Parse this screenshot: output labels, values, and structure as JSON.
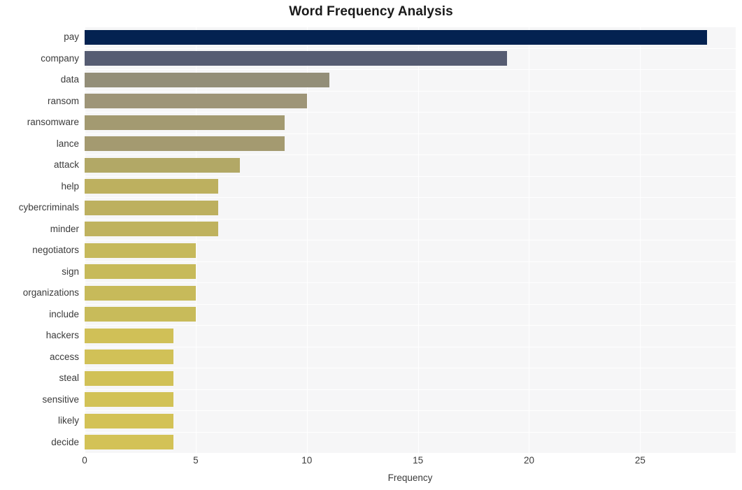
{
  "chart_data": {
    "type": "bar",
    "orientation": "horizontal",
    "title": "Word Frequency Analysis",
    "xlabel": "Frequency",
    "ylabel": "",
    "categories": [
      "pay",
      "company",
      "data",
      "ransom",
      "ransomware",
      "lance",
      "attack",
      "help",
      "cybercriminals",
      "minder",
      "negotiators",
      "sign",
      "organizations",
      "include",
      "hackers",
      "access",
      "steal",
      "sensitive",
      "likely",
      "decide"
    ],
    "values": [
      28,
      19,
      11,
      10,
      9,
      9,
      7,
      6,
      6,
      6,
      5,
      5,
      5,
      5,
      4,
      4,
      4,
      4,
      4,
      4
    ],
    "bar_colors": [
      "#042251",
      "#565c72",
      "#938e78",
      "#9e9578",
      "#a39a71",
      "#a49a70",
      "#b2a866",
      "#bdb05f",
      "#bdb05f",
      "#bfb25e",
      "#c6b95b",
      "#c7ba5a",
      "#c7ba5a",
      "#c8bb5a",
      "#d0c057",
      "#d1c157",
      "#d1c157",
      "#d2c256",
      "#d3c256",
      "#d3c256"
    ],
    "xlim": [
      0,
      29.3
    ],
    "xticks": [
      0,
      5,
      10,
      15,
      20,
      25
    ],
    "xticklabels": [
      "0",
      "5",
      "10",
      "15",
      "20",
      "25"
    ],
    "grid": true,
    "grid_color": "#ffffff",
    "plot_background": "#f6f6f7",
    "figure_background": "#ffffff",
    "legend": null,
    "title_color": "#1a1a1a",
    "tick_color": "#3b3b3b"
  }
}
